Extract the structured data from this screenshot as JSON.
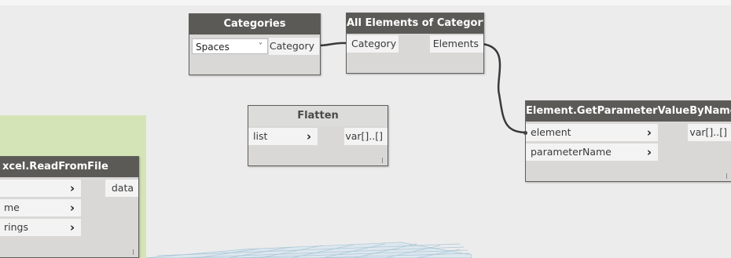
{
  "nodes": {
    "categories": {
      "title": "Categories",
      "dropdown_value": "Spaces",
      "output": "Category"
    },
    "all_elements": {
      "title": "All Elements of Category",
      "input": "Category",
      "output": "Elements"
    },
    "flatten": {
      "title": "Flatten",
      "input": "list",
      "output": "var[]..[]"
    },
    "get_param": {
      "title": "Element.GetParameterValueByName",
      "inputs": [
        "element",
        "parameterName"
      ],
      "output": "var[]..[]"
    },
    "excel": {
      "title": "xcel.ReadFromFile",
      "inputs": [
        "",
        "me",
        "rings"
      ],
      "output": "data"
    }
  },
  "icons": {
    "chevron": "›",
    "dropdown_caret": "˅"
  },
  "colors": {
    "background": "#ececec",
    "node_header": "#5c5a56",
    "node_body": "#d9d8d6",
    "group": "#d5e4b6",
    "wire": "#3a3a3a"
  }
}
